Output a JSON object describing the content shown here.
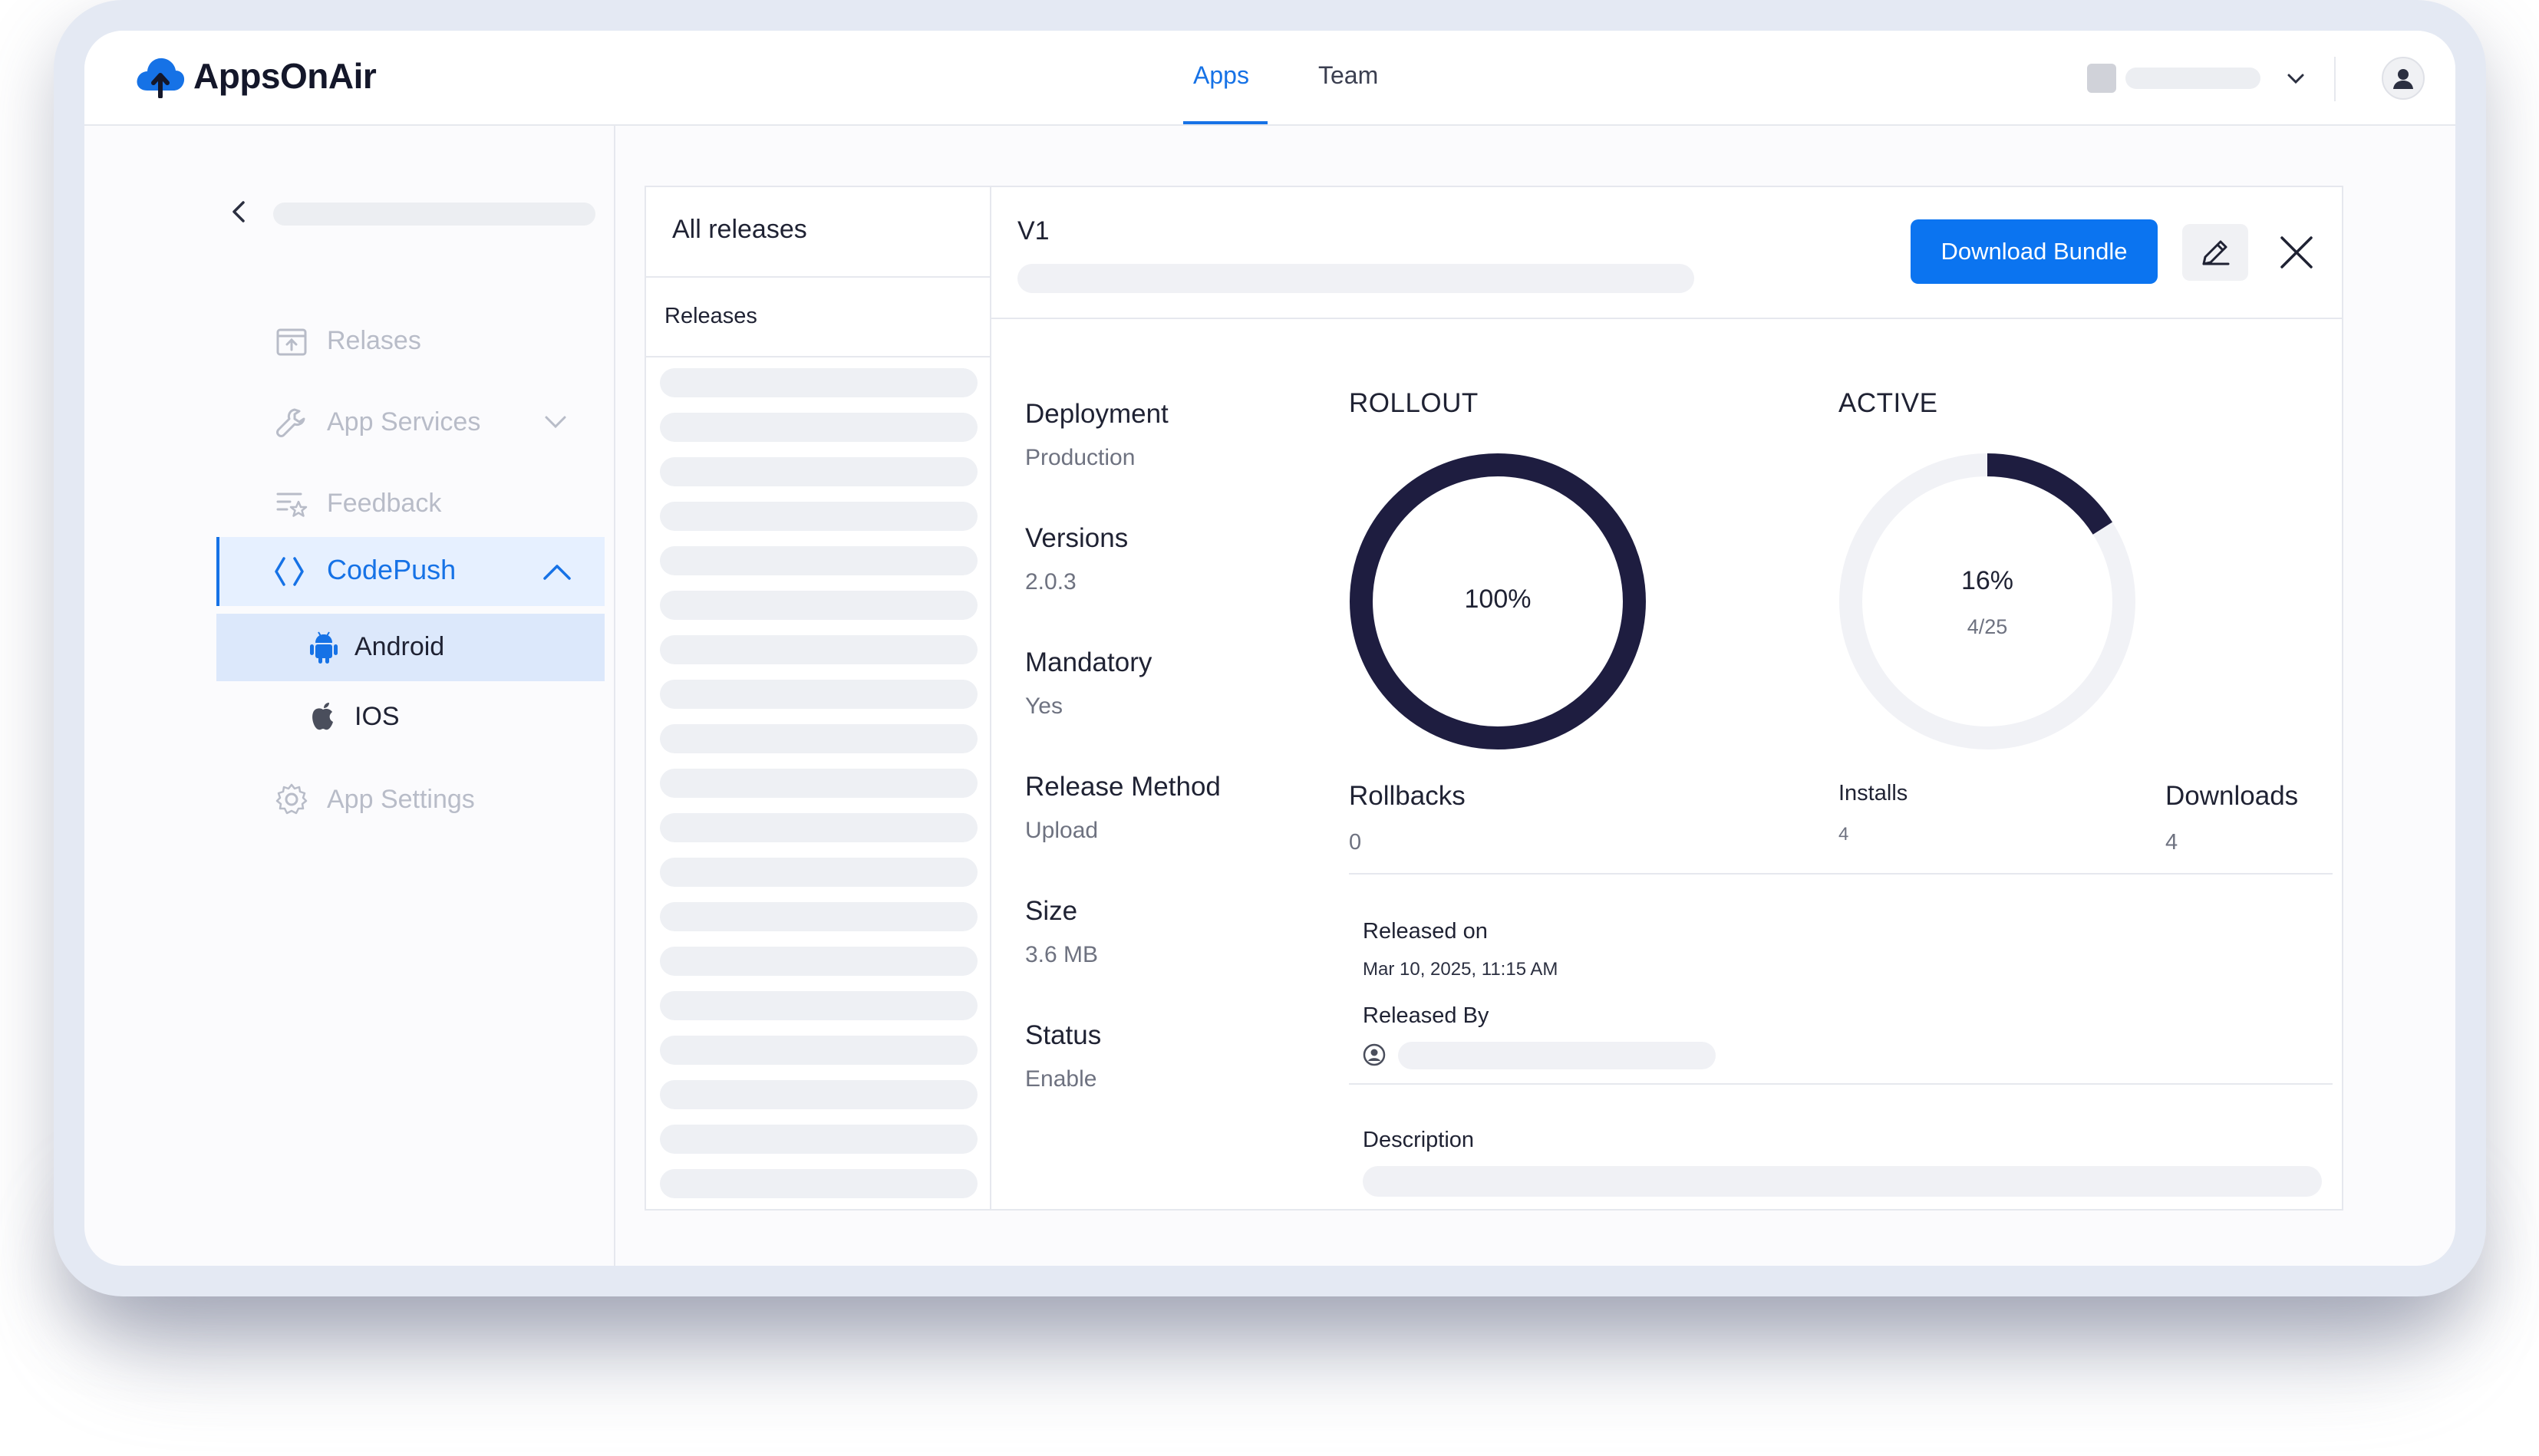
{
  "app": {
    "name": "AppsOnAir"
  },
  "nav": {
    "tabs": [
      {
        "label": "Apps",
        "active": true
      },
      {
        "label": "Team",
        "active": false
      }
    ]
  },
  "sidebar": {
    "items": [
      {
        "label": "Relases",
        "icon": "upload-box-icon"
      },
      {
        "label": "App Services",
        "icon": "wrench-icon"
      },
      {
        "label": "Feedback",
        "icon": "feedback-icon"
      },
      {
        "label": "CodePush",
        "icon": "code-icon",
        "active": true
      },
      {
        "label": "App Settings",
        "icon": "gear-icon"
      }
    ],
    "codepush_children": [
      {
        "label": "Android",
        "icon": "android-icon",
        "selected": true
      },
      {
        "label": "IOS",
        "icon": "apple-icon"
      }
    ]
  },
  "releases": {
    "header": "All releases",
    "subheader": "Releases"
  },
  "detail": {
    "version_title": "V1",
    "download_label": "Download Bundle",
    "fields": [
      {
        "label": "Deployment",
        "value": "Production"
      },
      {
        "label": "Versions",
        "value": "2.0.3"
      },
      {
        "label": "Mandatory",
        "value": "Yes"
      },
      {
        "label": "Release Method",
        "value": "Upload"
      },
      {
        "label": "Size",
        "value": "3.6 MB"
      },
      {
        "label": "Status",
        "value": "Enable"
      }
    ],
    "rollout": {
      "title": "ROLLOUT",
      "percent_label": "100%",
      "percent": 100
    },
    "active": {
      "title": "ACTIVE",
      "percent_label": "16%",
      "ratio": "4/25",
      "percent": 16
    },
    "rollbacks": {
      "label": "Rollbacks",
      "value": "0"
    },
    "installs": {
      "label": "Installs",
      "value": "4"
    },
    "downloads": {
      "label": "Downloads",
      "value": "4"
    },
    "released_on": {
      "label": "Released on",
      "value": "Mar 10, 2025, 11:15 AM"
    },
    "released_by": {
      "label": "Released By"
    },
    "description": {
      "label": "Description"
    }
  },
  "colors": {
    "accent": "#1672e6",
    "button": "#0b74f0",
    "donut": "#1e1d40",
    "track": "#f1f2f6"
  }
}
